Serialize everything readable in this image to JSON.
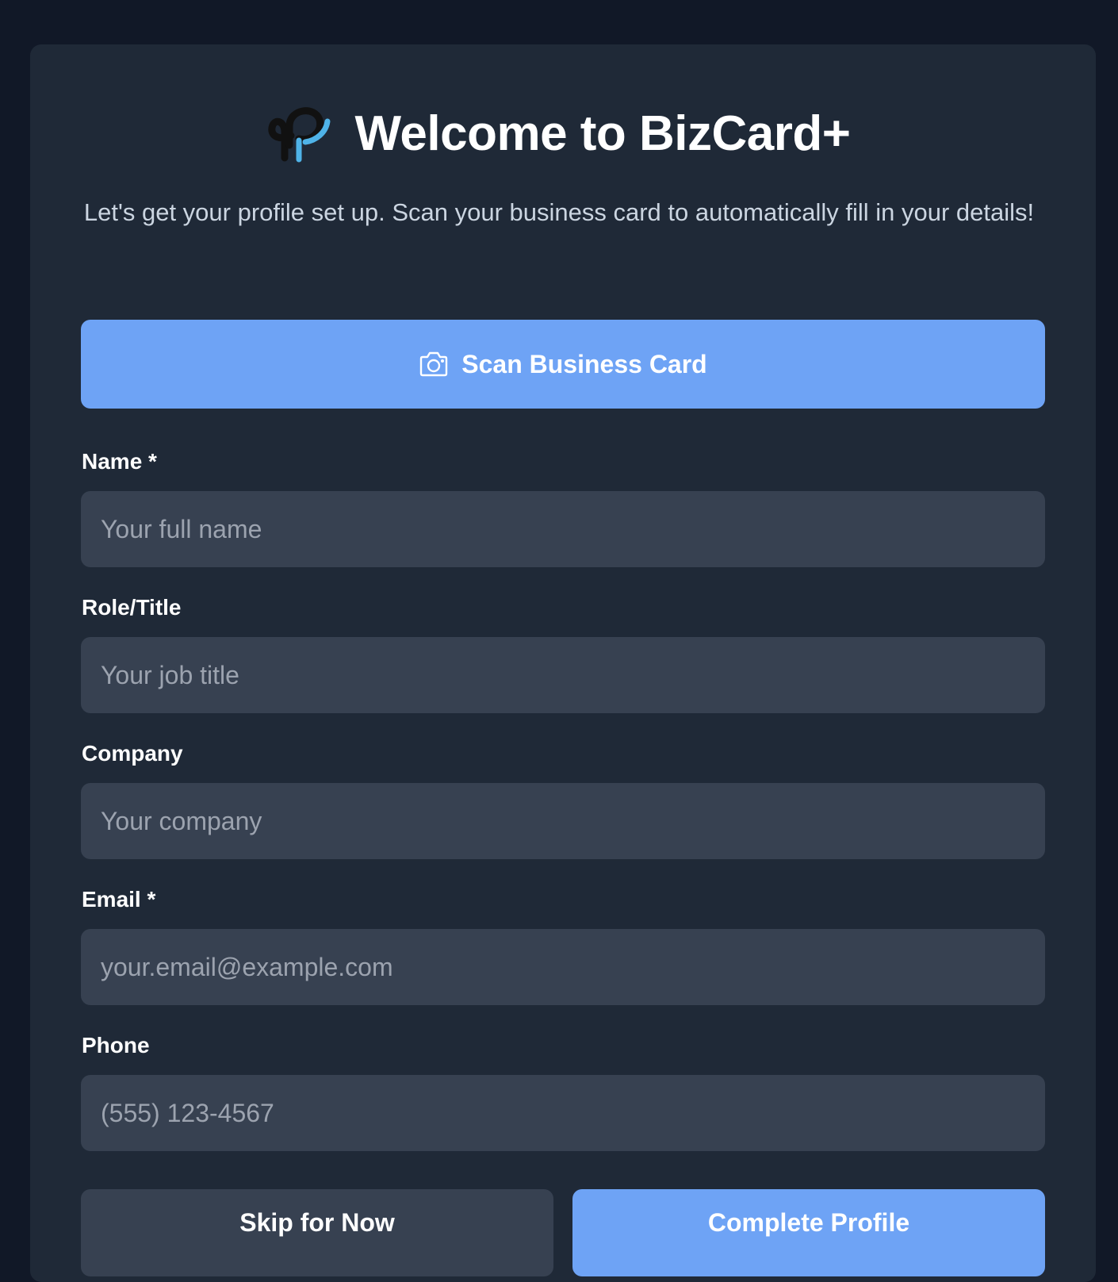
{
  "header": {
    "title": "Welcome to BizCard+",
    "subtitle": "Let's get your profile set up. Scan your business card to automatically fill in your details!"
  },
  "scan_button": {
    "label": "Scan Business Card",
    "icon": "camera-icon"
  },
  "form": {
    "name": {
      "label": "Name *",
      "placeholder": "Your full name",
      "value": ""
    },
    "role": {
      "label": "Role/Title",
      "placeholder": "Your job title",
      "value": ""
    },
    "company": {
      "label": "Company",
      "placeholder": "Your company",
      "value": ""
    },
    "email": {
      "label": "Email *",
      "placeholder": "your.email@example.com",
      "value": ""
    },
    "phone": {
      "label": "Phone",
      "placeholder": "(555) 123-4567",
      "value": ""
    }
  },
  "actions": {
    "skip_label": "Skip for Now",
    "complete_label": "Complete Profile"
  },
  "colors": {
    "page_bg": "#111827",
    "card_bg": "#1f2937",
    "input_bg": "#374151",
    "accent": "#6ea3f5",
    "logo_dark": "#111111",
    "logo_light": "#4fb3e8"
  }
}
